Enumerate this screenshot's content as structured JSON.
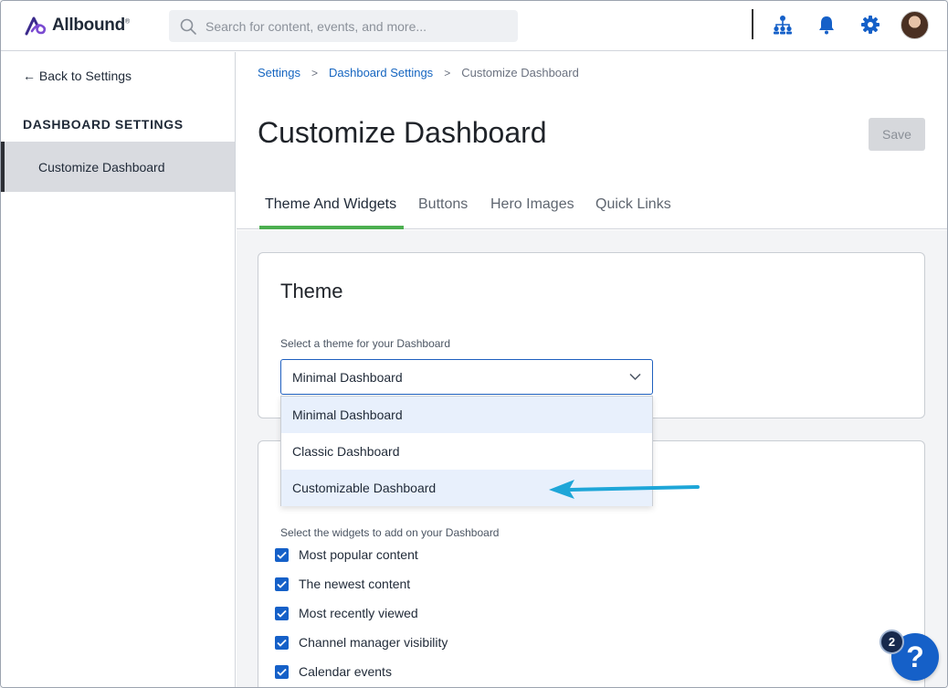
{
  "app": {
    "brand": "Allbound",
    "trademark": "®",
    "colors": {
      "accent": "#1560c8",
      "tab_active": "#4caf50",
      "arrow": "#1ea6d8"
    }
  },
  "search": {
    "placeholder": "Search for content, events, and more...",
    "value": ""
  },
  "header_icons": [
    "org-chart-icon",
    "bell-icon",
    "gear-icon",
    "avatar"
  ],
  "sidebar": {
    "back_label": "← Back to Settings",
    "heading": "DASHBOARD SETTINGS",
    "items": [
      {
        "label": "Customize Dashboard",
        "active": true
      }
    ]
  },
  "breadcrumb": {
    "items": [
      "Settings",
      "Dashboard Settings"
    ],
    "current": "Customize Dashboard",
    "separator": ">"
  },
  "page": {
    "title": "Customize Dashboard",
    "save_label": "Save"
  },
  "tabs": [
    {
      "label": "Theme And Widgets",
      "active": true
    },
    {
      "label": "Buttons",
      "active": false
    },
    {
      "label": "Hero Images",
      "active": false
    },
    {
      "label": "Quick Links",
      "active": false
    }
  ],
  "theme": {
    "title": "Theme",
    "label": "Select a theme for your Dashboard",
    "selected": "Minimal Dashboard",
    "options": [
      "Minimal Dashboard",
      "Classic Dashboard",
      "Customizable Dashboard"
    ]
  },
  "widgets": {
    "label": "Select the widgets to add on your Dashboard",
    "items": [
      {
        "label": "Most popular content",
        "checked": true
      },
      {
        "label": "The newest content",
        "checked": true
      },
      {
        "label": "Most recently viewed",
        "checked": true
      },
      {
        "label": "Channel manager visibility",
        "checked": true
      },
      {
        "label": "Calendar events",
        "checked": true
      }
    ]
  },
  "help": {
    "label": "?",
    "badge_count": "2"
  }
}
